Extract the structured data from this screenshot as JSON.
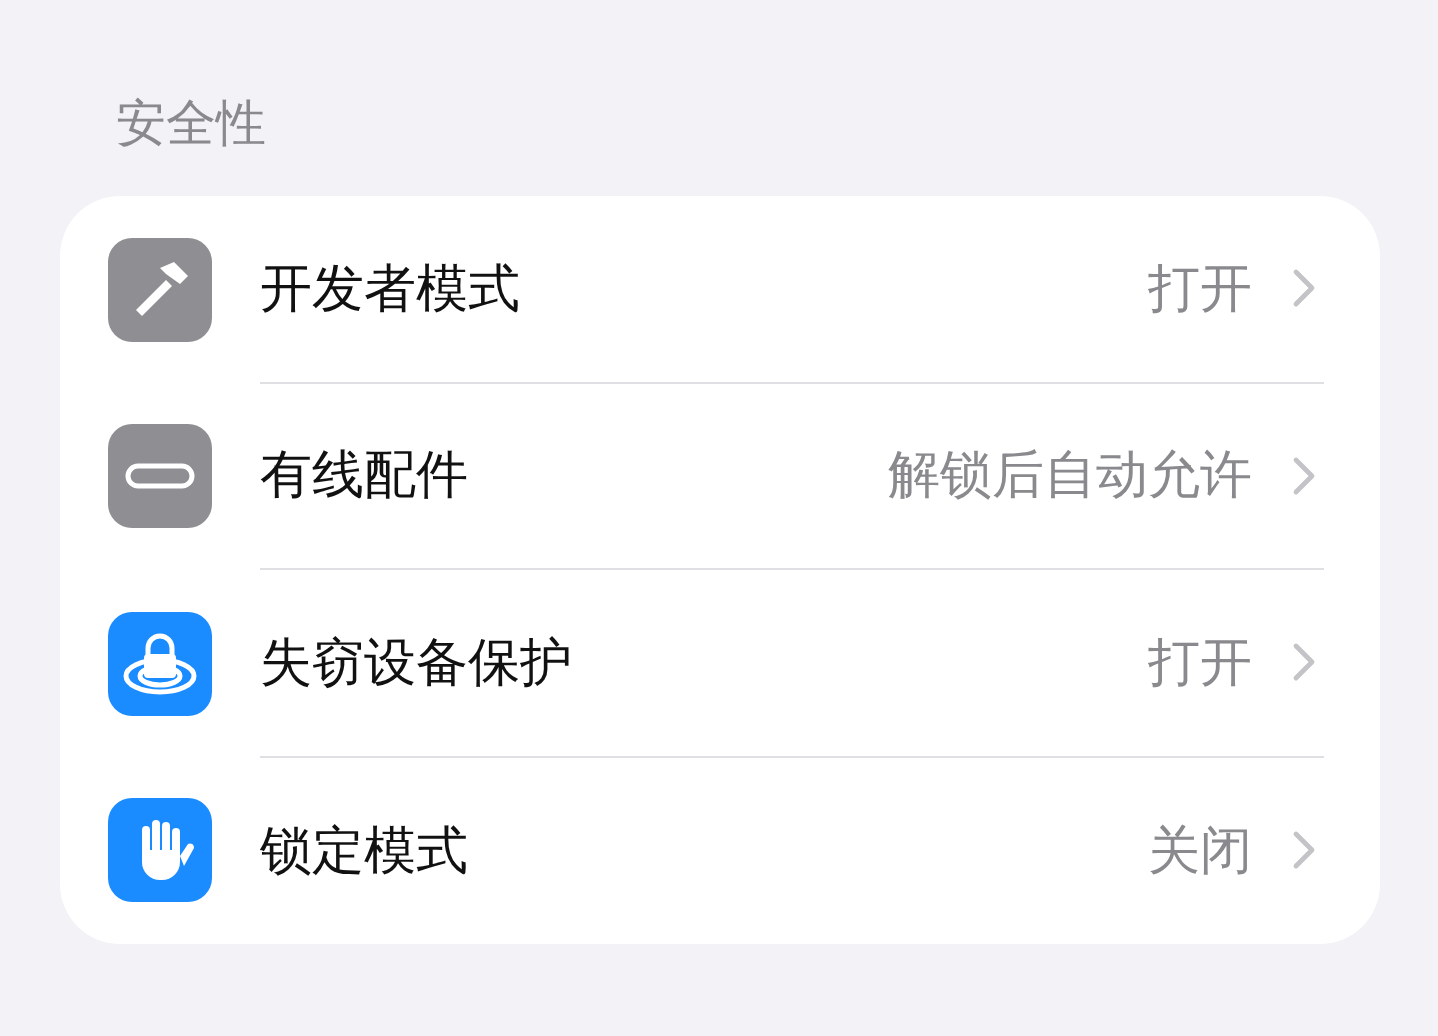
{
  "section": {
    "title": "安全性"
  },
  "items": [
    {
      "kind": "hammer",
      "color": "#8e8e93",
      "label": "开发者模式",
      "value": "打开"
    },
    {
      "kind": "port",
      "color": "#8e8e93",
      "label": "有线配件",
      "value": "解锁后自动允许"
    },
    {
      "kind": "lock",
      "color": "#1a8cff",
      "label": "失窃设备保护",
      "value": "打开"
    },
    {
      "kind": "hand",
      "color": "#1a8cff",
      "label": "锁定模式",
      "value": "关闭"
    }
  ]
}
